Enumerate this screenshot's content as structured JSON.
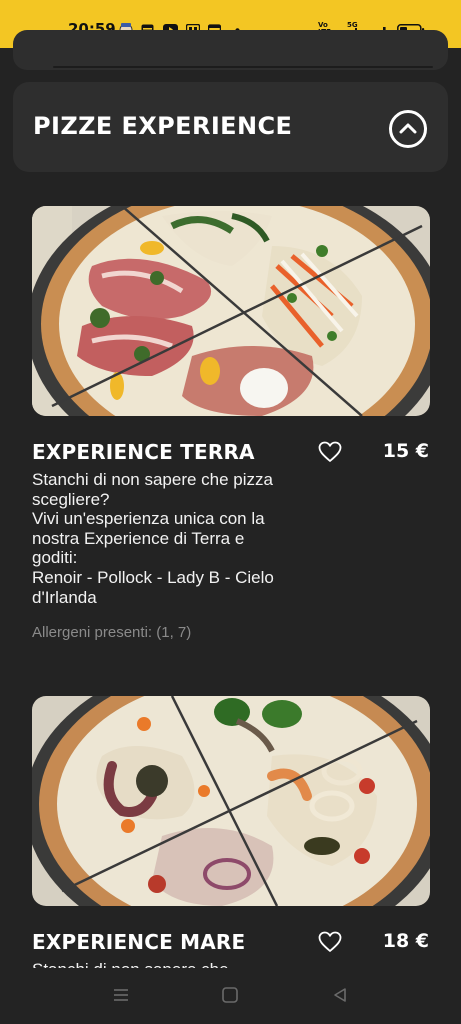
{
  "status_bar": {
    "time": "20:59",
    "volte_label": "Vo\nLTE",
    "network_label": "5G",
    "icons": [
      "messenger-icon",
      "wallet-icon",
      "youtube-icon",
      "gallery-icon",
      "calendar-icon",
      "notification-dot-icon",
      "signal-icon",
      "battery-icon"
    ]
  },
  "section": {
    "title": "PIZZE EXPERIENCE",
    "toggle_icon": "chevron-up-circle-icon"
  },
  "products": [
    {
      "title": "EXPERIENCE TERRA",
      "price": "15 €",
      "description": "Stanchi di non sapere che pizza scegliere?\nVivi un'esperienza unica con la nostra Experience di Terra e goditi:\nRenoir - Pollock - Lady B - Cielo d'Irlanda",
      "allergens": "Allergeni presenti: (1, 7)",
      "image": "pizza-terra-photo"
    },
    {
      "title": "EXPERIENCE MARE",
      "price": "18 €",
      "description": "Stanchi di non sapere che",
      "image": "pizza-mare-photo"
    }
  ],
  "nav": {
    "icons": [
      "menu-icon",
      "home-icon",
      "back-icon"
    ]
  },
  "colors": {
    "background": "#232323",
    "card": "#2e2e2e",
    "accent_status_bar": "#f3c623",
    "text": "#ffffff",
    "muted_text": "#8a8a8a"
  }
}
